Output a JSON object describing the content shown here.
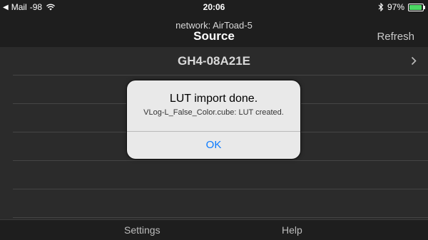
{
  "status_bar": {
    "back_arrow": "◀",
    "carrier": "Mail",
    "signal": "-98",
    "time": "20:06",
    "battery_percent": "97%",
    "battery_level": 0.97,
    "battery_color": "#4cd964",
    "icons": [
      "back-arrow-icon",
      "wifi-icon",
      "bluetooth-icon",
      "battery-icon"
    ]
  },
  "nav": {
    "subtitle": "network: AirToad-5",
    "title": "Source",
    "refresh_label": "Refresh"
  },
  "list": {
    "rows": [
      {
        "label": "GH4-08A21E",
        "icon": "chevron-right-icon"
      }
    ]
  },
  "tabs": [
    {
      "label": "Settings"
    },
    {
      "label": "Help"
    }
  ],
  "alert": {
    "title": "LUT import done.",
    "message": "VLog-L_False_Color.cube: LUT created.",
    "button_label": "OK",
    "button_color": "#0a7aff"
  }
}
